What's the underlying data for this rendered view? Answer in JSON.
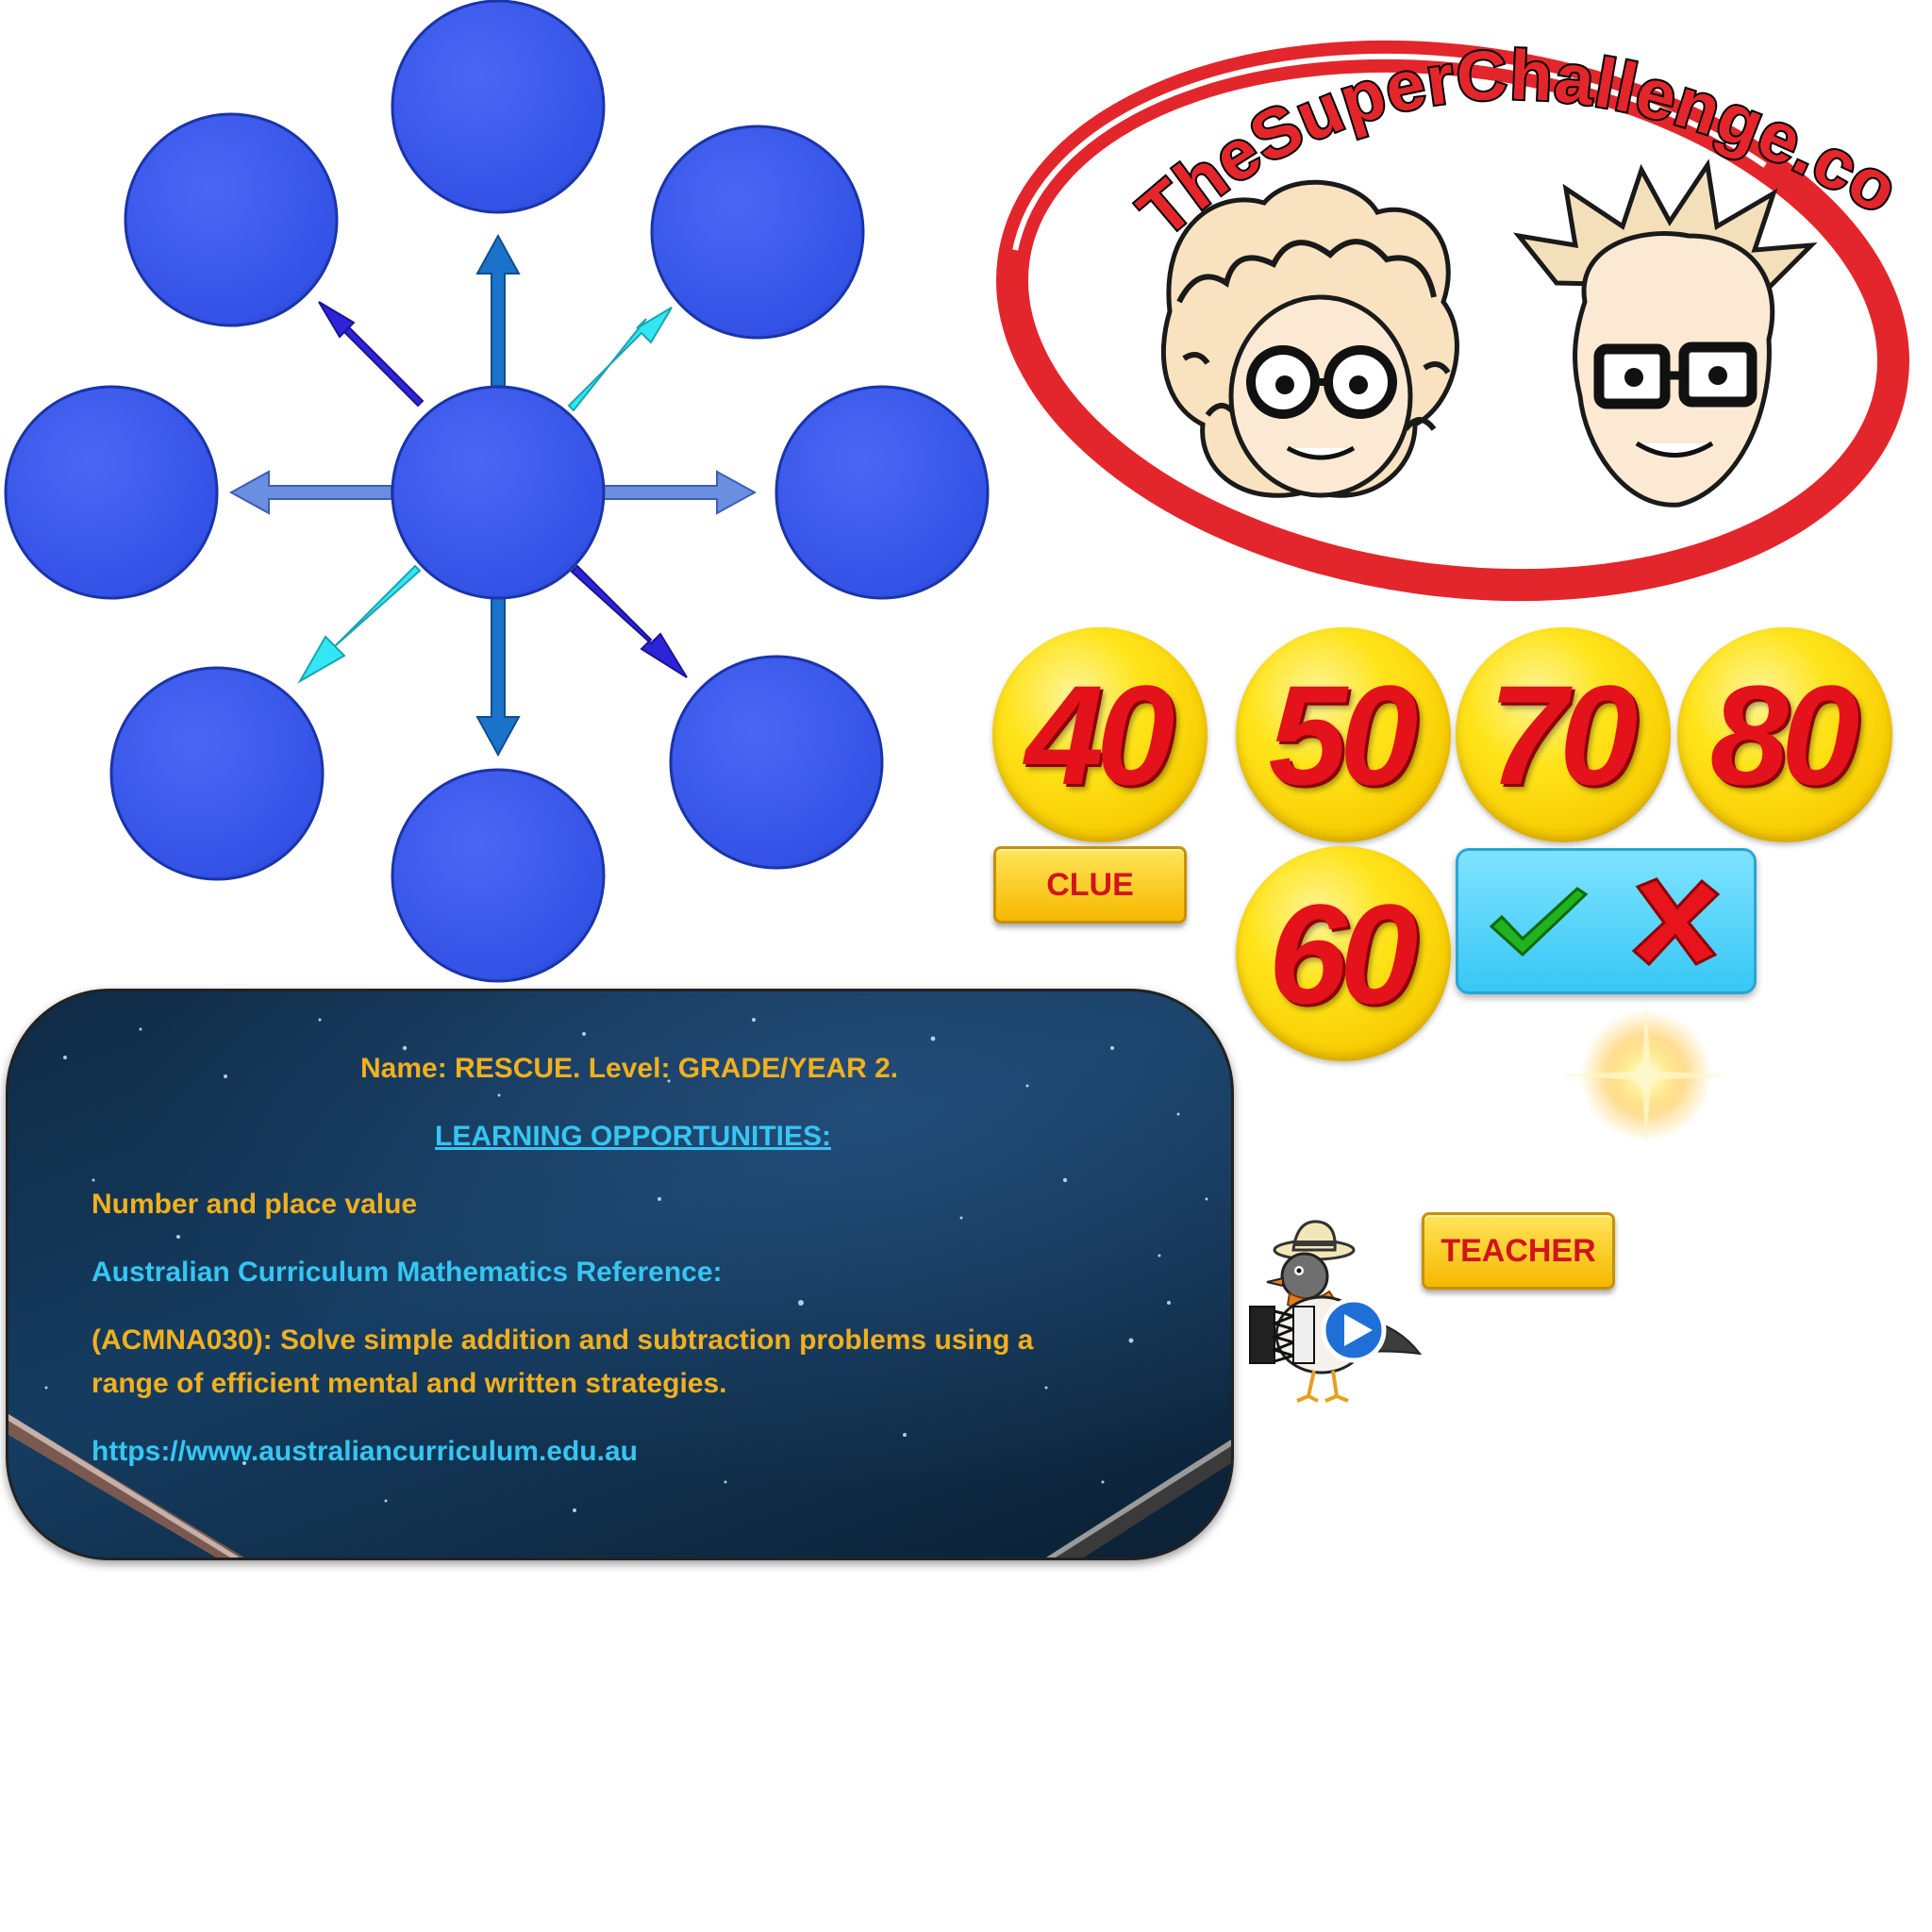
{
  "logo": {
    "text": "TheSuperChallenge.com"
  },
  "tokens": [
    {
      "label": "40"
    },
    {
      "label": "50"
    },
    {
      "label": "70"
    },
    {
      "label": "80"
    },
    {
      "label": "60"
    }
  ],
  "buttons": {
    "clue_label": "CLUE",
    "teacher_label": "TEACHER"
  },
  "info": {
    "title": "Name: RESCUE. Level: GRADE/YEAR 2.",
    "section_heading": "LEARNING OPPORTUNITIES:",
    "topic": "Number and place value",
    "reference_label": "Australian Curriculum Mathematics Reference:",
    "reference_line1": "(ACMNA030): Solve simple addition and subtraction problems using a",
    "reference_line2": "range of efficient mental and written strategies.",
    "link": "https://www.australiancurriculum.edu.au"
  },
  "colors": {
    "node_blue": "#3a57ec",
    "token_yellow": "#ffe41a",
    "number_red": "#e4121a",
    "panel_cyan": "#4dd3fa",
    "info_gold": "#f2b01e",
    "info_cyan": "#36c6f2",
    "logo_red": "#e3262c"
  }
}
